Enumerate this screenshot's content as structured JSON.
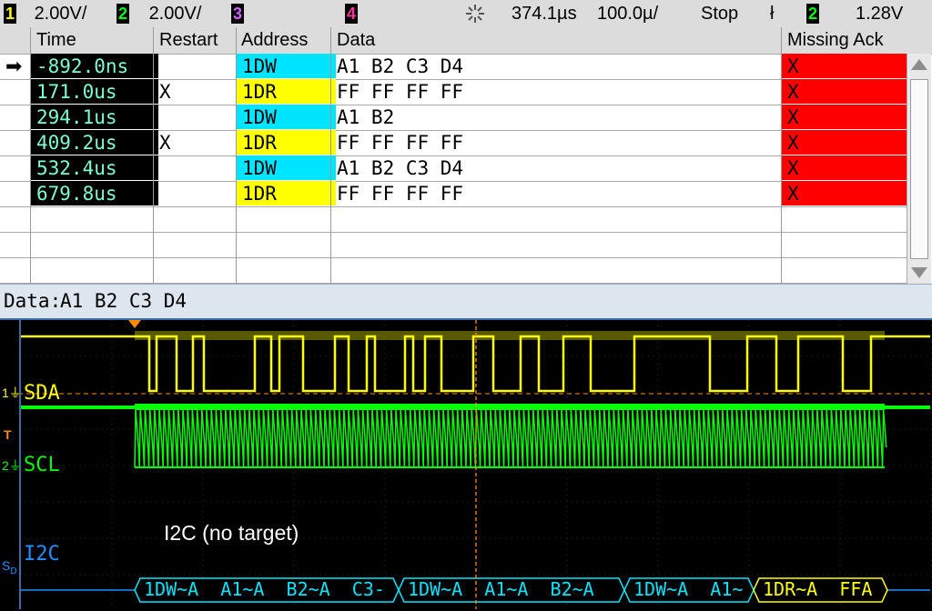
{
  "statusbar": {
    "ch1": {
      "num": "1",
      "scale": "2.00V/",
      "color": "#ffff00"
    },
    "ch2": {
      "num": "2",
      "scale": "2.00V/",
      "color": "#00ff00"
    },
    "ch3": {
      "num": "3",
      "color": "#cc66ff"
    },
    "ch4": {
      "num": "4",
      "color": "#ff3399"
    },
    "delay": "374.1µs",
    "timebase": "100.0µ/",
    "run_state": "Stop",
    "trigger_edge": "ł",
    "trigger_source": "2",
    "trigger_level": "1.28V"
  },
  "table": {
    "headers": [
      "Time",
      "Restart",
      "Address",
      "Data",
      "Missing Ack"
    ],
    "rows": [
      {
        "time": "-892.0ns",
        "restart": "",
        "address": "1DW",
        "data": "A1 B2 C3 D4",
        "missing_ack": "X",
        "selected": true
      },
      {
        "time": "171.0us",
        "restart": "X",
        "address": "1DR",
        "data": "FF FF FF FF",
        "missing_ack": "X"
      },
      {
        "time": "294.1us",
        "restart": "",
        "address": "1DW",
        "data": "A1 B2",
        "missing_ack": "X"
      },
      {
        "time": "409.2us",
        "restart": "X",
        "address": "1DR",
        "data": "FF FF FF FF",
        "missing_ack": "X"
      },
      {
        "time": "532.4us",
        "restart": "",
        "address": "1DW",
        "data": "A1 B2 C3 D4",
        "missing_ack": "X"
      },
      {
        "time": "679.8us",
        "restart": "",
        "address": "1DR",
        "data": "FF FF FF FF",
        "missing_ack": "X"
      }
    ],
    "empty_rows": 3,
    "colors": {
      "write": "#00e5ff",
      "read": "#ffff00",
      "ack": "#ff0000"
    }
  },
  "data_strip": {
    "label": "Data:",
    "value": "A1 B2 C3 D4"
  },
  "scope": {
    "sda_label": "SDA",
    "scl_label": "SCL",
    "i2c_label": "I2C",
    "annotation": "I2C (no target)",
    "bus_frames": [
      {
        "text": "1DW~A  A1~A  B2~A  C3-",
        "color": "#00e5ff"
      },
      {
        "text": "1DW~A  A1~A  B2~A",
        "color": "#00e5ff"
      },
      {
        "text": "1DW~A  A1~",
        "color": "#00e5ff"
      },
      {
        "text": "1DR~A  FFA",
        "color": "#ffff00"
      }
    ]
  }
}
